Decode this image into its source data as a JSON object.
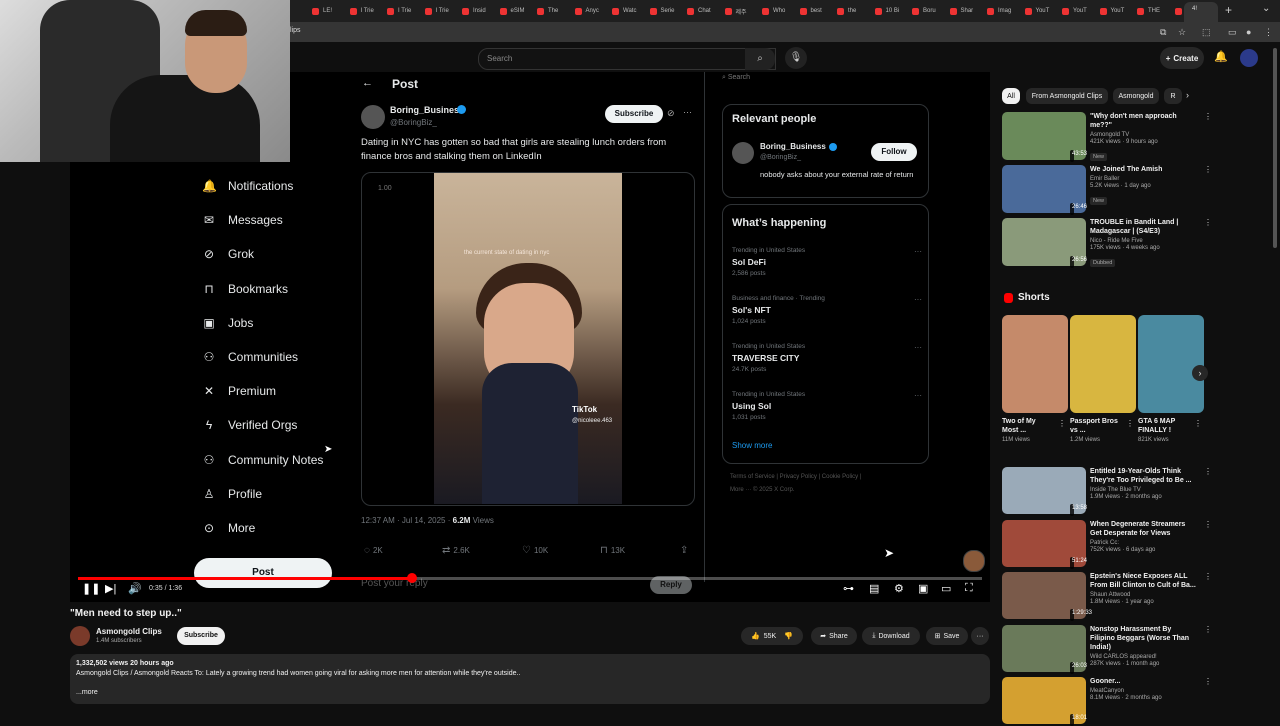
{
  "browser": {
    "tabs": [
      "LE!",
      "I Trie",
      "I Trie",
      "I Trie",
      "Insid",
      "eSIM",
      "The",
      "Anyc",
      "Watc",
      "Serie",
      "Chat",
      "제주",
      "Who",
      "best",
      "the",
      "10 Bi",
      "Boru",
      "Shar",
      "Imag",
      "YouT",
      "YouT",
      "YouT",
      "THE",
      "Clips"
    ],
    "active_tab_label": "4!",
    "address_partial": "lips"
  },
  "youtube_header": {
    "search_placeholder": "Search",
    "create_label": "Create"
  },
  "x_page": {
    "header_title": "Post",
    "nav_items": [
      {
        "label": "Notifications",
        "icon": "bell-icon"
      },
      {
        "label": "Messages",
        "icon": "envelope-icon"
      },
      {
        "label": "Grok",
        "icon": "grok-icon"
      },
      {
        "label": "Bookmarks",
        "icon": "bookmark-icon"
      },
      {
        "label": "Jobs",
        "icon": "briefcase-icon"
      },
      {
        "label": "Communities",
        "icon": "people-icon"
      },
      {
        "label": "Premium",
        "icon": "x-logo-icon"
      },
      {
        "label": "Verified Orgs",
        "icon": "lightning-icon"
      },
      {
        "label": "Community Notes",
        "icon": "people-icon"
      },
      {
        "label": "Profile",
        "icon": "person-icon"
      },
      {
        "label": "More",
        "icon": "more-circle-icon"
      }
    ],
    "post_button": "Post",
    "tweet": {
      "author": "Boring_Business",
      "handle": "@BoringBiz_",
      "subscribe": "Subscribe",
      "text": "Dating in NYC has gotten so bad that girls are stealing lunch orders from finance bros and stalking them on LinkedIn",
      "speed": "1.00",
      "overlay_caption": "the current state of dating in nyc",
      "watermark": "TikTok",
      "watermark_user": "@nicoleee.463",
      "timestamp": "12:37 AM · Jul 14, 2025 ·",
      "views_count": "6.2M",
      "views_label": "Views",
      "replies": "2K",
      "reposts": "2.6K",
      "likes": "10K",
      "bookmarks": "13K",
      "reply_placeholder": "Post your reply",
      "reply_button": "Reply"
    },
    "search_placeholder": "Search",
    "relevant_people": {
      "title": "Relevant people",
      "name": "Boring_Business",
      "handle": "@BoringBiz_",
      "follow": "Follow",
      "bio": "nobody asks about your external rate of return"
    },
    "whats_happening": {
      "title": "What’s happening",
      "trends": [
        {
          "context": "Trending in United States",
          "name": "Sol DeFi",
          "posts": "2,586 posts"
        },
        {
          "context": "Business and finance · Trending",
          "name": "Sol's NFT",
          "posts": "1,024 posts"
        },
        {
          "context": "Trending in United States",
          "name": "TRAVERSE CITY",
          "posts": "24.7K posts"
        },
        {
          "context": "Trending in United States",
          "name": "Using Sol",
          "posts": "1,031 posts"
        }
      ],
      "show_more": "Show more"
    },
    "footer_line1": "Terms of Service  |  Privacy Policy  |  Cookie Policy  |",
    "footer_line2": "More ···   © 2025 X Corp."
  },
  "player": {
    "time": "0:35 / 1:36",
    "progress": 0.37
  },
  "video": {
    "title": "\"Men need to step up..\"",
    "channel": "Asmongold Clips",
    "subscribers": "1.4M subscribers",
    "subscribe": "Subscribe",
    "likes": "55K",
    "share": "Share",
    "download": "Download",
    "save": "Save",
    "stats": "1,332,502 views  20 hours ago",
    "description": "Asmongold Clips / Asmongold Reacts To: Lately a growing trend had women going viral for asking more men for attention while they're outside..",
    "more": "...more"
  },
  "sidebar": {
    "chips": [
      "All",
      "From Asmongold Clips",
      "Asmongold",
      "R"
    ],
    "recs_top": [
      {
        "title": "\"Why don't men approach me??\"",
        "channel": "Asmongold TV",
        "meta": "421K views · 9 hours ago",
        "badge": "New",
        "duration": "43:53",
        "color": "#6a8a5a"
      },
      {
        "title": "We Joined The Amish",
        "channel": "Emir Baller",
        "meta": "5.2K views · 1 day ago",
        "badge": "New",
        "duration": "26:46",
        "color": "#4a6a9a"
      },
      {
        "title": "TROUBLE in Bandit Land | Madagascar | (S4/E3)",
        "channel": "Nico - Ride Me Five",
        "meta": "175K views · 4 weeks ago",
        "badge": "Dubbed",
        "duration": "26:56",
        "color": "#8a9a7a"
      }
    ],
    "shorts_title": "Shorts",
    "shorts": [
      {
        "title": "Two of My Most ...",
        "views": "11M views",
        "color": "#c58a6a"
      },
      {
        "title": "Passport Bros vs ...",
        "views": "1.2M views",
        "color": "#d8b640"
      },
      {
        "title": "GTA 6 MAP FINALLY !",
        "views": "821K views",
        "color": "#4a8aa0"
      }
    ],
    "recs_bottom": [
      {
        "title": "Entitled 19-Year-Olds Think They're Too Privileged to Be ...",
        "channel": "Inside The Blue TV",
        "meta": "1.9M views · 2 months ago",
        "duration": "13:58",
        "color": "#9aaab8"
      },
      {
        "title": "When Degenerate Streamers Get Desperate for Views",
        "channel": "Patrick Cc:",
        "meta": "752K views · 6 days ago",
        "duration": "51:24",
        "color": "#a04a3a"
      },
      {
        "title": "Epstein's Niece Exposes ALL From Bill Clinton to Cult of Ba...",
        "channel": "Shaun Attwood",
        "meta": "1.8M views · 1 year ago",
        "duration": "1:29:33",
        "color": "#7a5a4a"
      },
      {
        "title": "Nonstop Harassment By Filipino Beggars (Worse Than India!)",
        "channel": "Wild CARLOS appeared!",
        "meta": "287K views · 1 month ago",
        "duration": "26:03",
        "color": "#6a7a5a"
      },
      {
        "title": "Gooner...",
        "channel": "MeatCanyon",
        "meta": "8.1M views · 2 months ago",
        "duration": "18:01",
        "color": "#d4a030"
      }
    ]
  }
}
